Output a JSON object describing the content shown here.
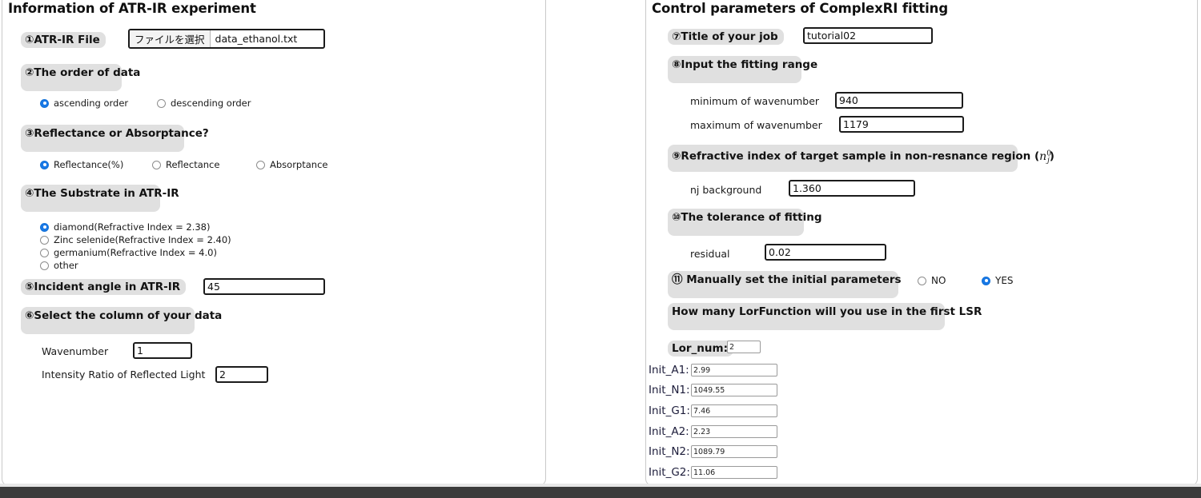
{
  "left_panel": {
    "title": "Information of ATR-IR experiment",
    "file_section": {
      "label": "①ATR-IR File",
      "button_label": "ファイルを選択",
      "file_name": "data_ethanol.txt"
    },
    "order_section": {
      "label": "②The order of data",
      "options": [
        {
          "label": "ascending order",
          "selected": true
        },
        {
          "label": "descending order",
          "selected": false
        }
      ]
    },
    "reflectance_section": {
      "label": "③Reflectance or Absorptance?",
      "options": [
        {
          "label": "Reflectance(%)",
          "selected": true
        },
        {
          "label": "Reflectance",
          "selected": false
        },
        {
          "label": "Absorptance",
          "selected": false
        }
      ]
    },
    "substrate_section": {
      "label": "④The Substrate in ATR-IR",
      "options": [
        {
          "label": "diamond(Refractive Index = 2.38)",
          "selected": true
        },
        {
          "label": "Zinc selenide(Refractive Index = 2.40)",
          "selected": false
        },
        {
          "label": "germanium(Refractive Index = 4.0)",
          "selected": false
        },
        {
          "label": "other",
          "selected": false
        }
      ]
    },
    "incident_angle": {
      "label": "⑤Incident angle in ATR-IR",
      "value": "45"
    },
    "column_section": {
      "label": "⑥Select the column of your data",
      "fields": [
        {
          "label": "Wavenumber",
          "value": "1"
        },
        {
          "label": "Intensity Ratio of Reflected Light",
          "value": "2"
        }
      ]
    }
  },
  "right_panel": {
    "title": "Control parameters of ComplexRI fitting",
    "job_title": {
      "label": "⑦Title of your job",
      "value": "tutorial02"
    },
    "fitting_range": {
      "label": "⑧Input the fitting range",
      "fields": [
        {
          "label": "minimum of wavenumber",
          "value": "940"
        },
        {
          "label": "maximum of wavenumber",
          "value": "1179"
        }
      ]
    },
    "refractive_index": {
      "label_prefix": "⑨Refractive index of target sample in non-resnance region (",
      "label_symbol": "n",
      "label_sup": "0",
      "label_sub": "j",
      "label_suffix": ")",
      "field": {
        "label": "nj background",
        "value": "1.360"
      }
    },
    "tolerance": {
      "label": "⑩The tolerance of fitting",
      "field": {
        "label": "residual",
        "value": "0.02"
      }
    },
    "manual_init": {
      "label": "⑪ Manually set the initial parameters",
      "options": [
        {
          "label": "NO",
          "selected": false
        },
        {
          "label": "YES",
          "selected": true
        }
      ]
    },
    "lor_question": "How many LorFunction will you use in the first LSR",
    "lor_num": {
      "label": "Lor_num:",
      "value": "2"
    },
    "init_params": [
      {
        "label": "Init_A1:",
        "value": "2.99"
      },
      {
        "label": "Init_N1:",
        "value": "1049.55"
      },
      {
        "label": "Init_G1:",
        "value": "7.46"
      },
      {
        "label": "Init_A2:",
        "value": "2.23"
      },
      {
        "label": "Init_N2:",
        "value": "1089.79"
      },
      {
        "label": "Init_G2:",
        "value": "11.06"
      }
    ]
  },
  "colors": {
    "radio_accent": "#1878e6",
    "section_label_bg": "#e0e0e0",
    "panel_border": "#c9c9c9",
    "bottom_bar": "#3b3b3b"
  }
}
